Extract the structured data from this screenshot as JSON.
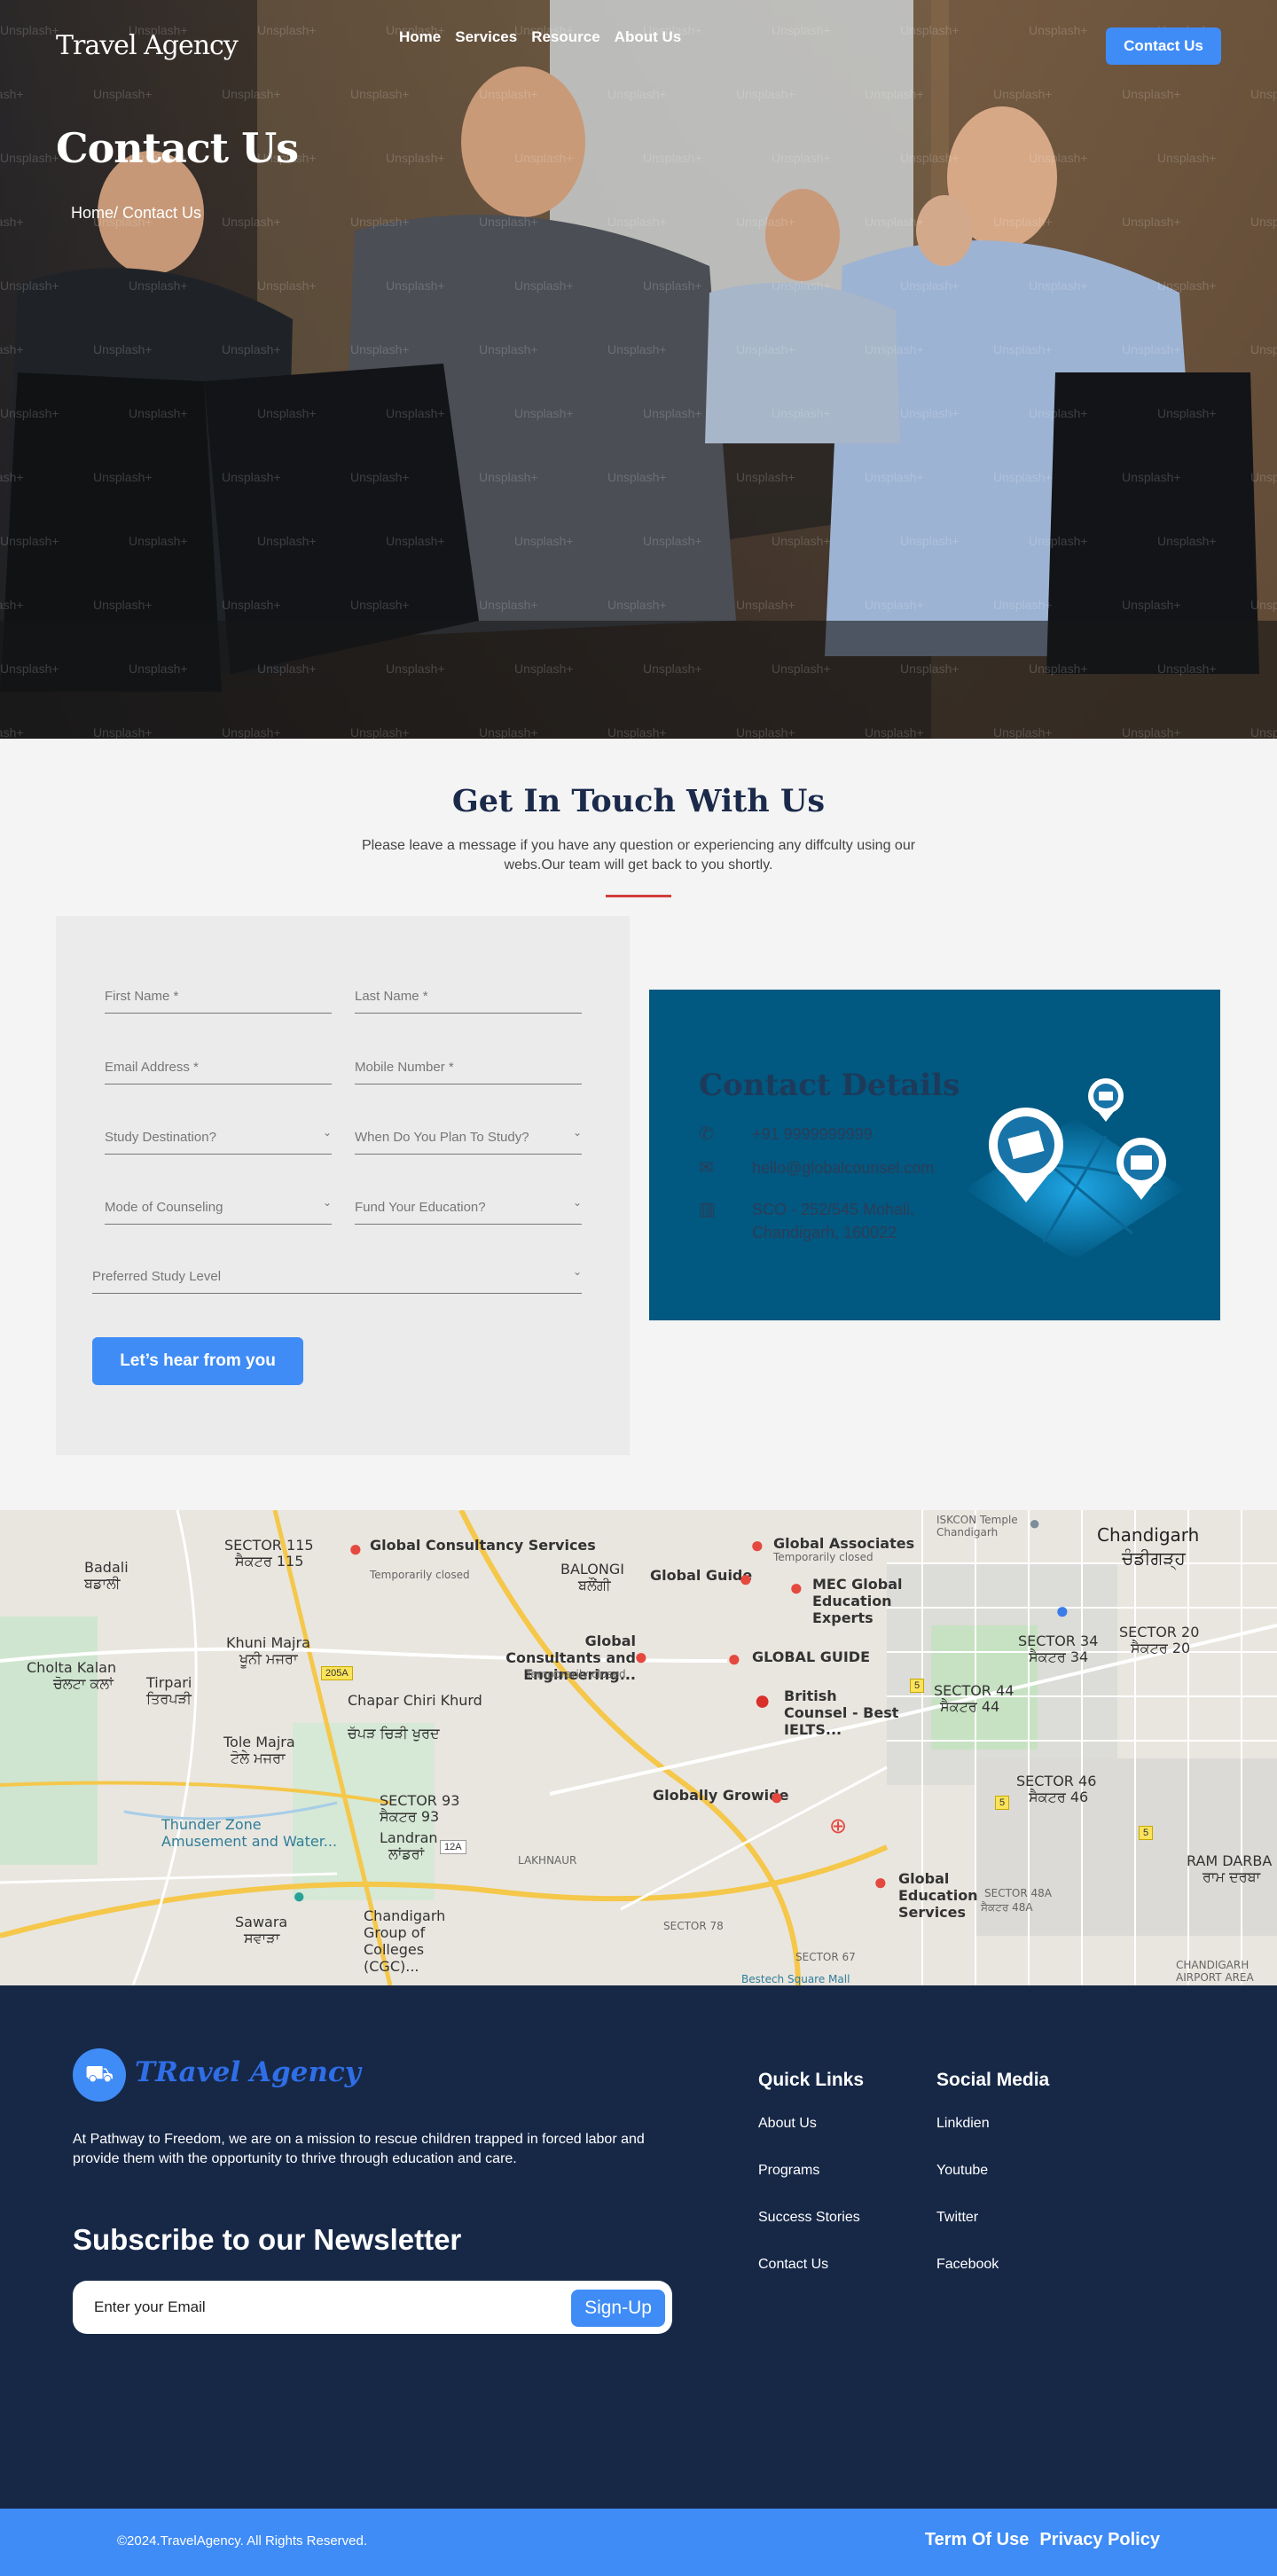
{
  "nav": {
    "logo": "Travel Agency",
    "links": [
      "Home",
      "Services",
      "Resource",
      "About Us"
    ],
    "cta": "Contact Us"
  },
  "hero": {
    "title": "Contact Us",
    "breadcrumb": "Home/ Contact Us",
    "watermark": "Unsplash+"
  },
  "contact": {
    "heading": "Get In Touch With Us",
    "lede": "Please leave a message if you have any question or experiencing any diffculty using our webs.Our team will get back to you shortly.",
    "form": {
      "first_name": "First Name *",
      "last_name": "Last Name *",
      "email": "Email Address *",
      "mobile": "Mobile Number *",
      "destination": "Study Destination?",
      "when": "When Do You Plan To Study?",
      "mode": "Mode of Counseling",
      "fund": "Fund Your Education?",
      "level": "Preferred Study Level",
      "submit": "Let’s hear from you"
    },
    "details": {
      "title": "Contact Details",
      "phone": "+91 9999999999",
      "email": "hello@globalcounsel.com",
      "address_line1": "SCO - 252/545 Mohali,",
      "address_line2": "Chandigarh, 160022"
    }
  },
  "map": {
    "labels": {
      "sector115": "SECTOR 115",
      "sector115_pa": "ਸੈਕਟਰ 115",
      "badali": "Badali",
      "badali_pa": "ਬਡਾਲੀ",
      "balongi": "BALONGI",
      "balongi_pa": "ਬਲੌਂਗੀ",
      "khuni_majra": "Khuni Majra",
      "khuni_majra_pa": "ਖੂਨੀ ਮਜਰਾ",
      "cholta_kalan": "Cholta Kalan",
      "cholta_kalan_pa": "ਚੋਲਟਾ ਕਲਾਂ",
      "tirpari": "Tirpari",
      "tirpari_pa": "ਤਿਰਪੜੀ",
      "chapar": "Chapar Chiri Khurd",
      "chapar_pa": "ਚੱਪੜ ਚਿੜੀ ਖੁਰਦ",
      "tole_majra": "Tole Majra",
      "tole_majra_pa": "ਟੋਲੇ ਮਜਰਾ",
      "sector93": "SECTOR 93",
      "sector93_pa": "ਸੈਕਟਰ 93",
      "landran": "Landran",
      "landran_pa": "ਲਾਂਡਰਾਂ",
      "thunder": "Thunder Zone Amusement and Water...",
      "sawara": "Sawara",
      "sawara_pa": "ਸਵਾੜਾ",
      "cgc": "Chandigarh Group of Colleges (CGC)...",
      "chandigarh": "Chandigarh",
      "chandigarh_pa": "ਚੰਡੀਗੜ੍ਹ",
      "sector34": "SECTOR 34",
      "sector34_pa": "ਸੈਕਟਰ 34",
      "sector20": "SECTOR 20",
      "sector20_pa": "ਸੈਕਟਰ 20",
      "sector44": "SECTOR 44",
      "sector44_pa": "ਸੈਕਟਰ 44",
      "sector46": "SECTOR 46",
      "sector46_pa": "ਸੈਕਟਰ 46",
      "sector48a": "SECTOR 48A",
      "sector48a_pa": "ਸੈਕਟਰ 48A",
      "ram_darbar": "RAM DARBA",
      "ram_darbar_pa": "ਰਾਮ ਦਰਬਾ",
      "lakhnaur": "LAKHNAUR",
      "sector78": "SECTOR 78",
      "sector67": "SECTOR 67",
      "airport_area": "CHANDIGARH AIRPORT AREA",
      "iskcon": "ISKCON Temple Chandigarh",
      "bestech": "Bestech Square Mall"
    },
    "places": [
      {
        "name": "Global Consultancy Services",
        "note": "Temporarily closed"
      },
      {
        "name": "Global Guide",
        "note": ""
      },
      {
        "name": "Global Associates",
        "note": "Temporarily closed"
      },
      {
        "name": "MEC Global Education Experts",
        "note": ""
      },
      {
        "name": "Global Consultants and Engineering...",
        "note": "Temporarily closed"
      },
      {
        "name": "GLOBAL GUIDE",
        "note": ""
      },
      {
        "name": "British Counsel - Best IELTS...",
        "note": ""
      },
      {
        "name": "Globally Growide",
        "note": ""
      },
      {
        "name": "Global Education Services",
        "note": ""
      }
    ],
    "road_badges": [
      "205A",
      "12A",
      "5",
      "5",
      "5"
    ]
  },
  "footer": {
    "brand": "TRavel Agency",
    "mission": "At Pathway to Freedom, we are on a mission to rescue children trapped in forced labor and provide them with the opportunity to thrive through education and care.",
    "subscribe_title": "Subscribe to our Newsletter",
    "subscribe_placeholder": "Enter your Email",
    "subscribe_button": "Sign-Up",
    "quick_links_title": "Quick Links",
    "quick_links": [
      "About Us",
      "Programs",
      "Success Stories",
      "Contact Us"
    ],
    "social_title": "Social Media",
    "social_links": [
      "Linkdien",
      "Youtube",
      "Twitter",
      "Facebook"
    ]
  },
  "bottom": {
    "copyright": "©2024.TravelAgency. All Rights Reserved.",
    "terms": "Term Of Use",
    "privacy": "Privacy Policy"
  },
  "colors": {
    "accent": "#3f8cf6",
    "navy": "#172847",
    "details_bg": "#015880",
    "rule": "#d23c3c"
  }
}
